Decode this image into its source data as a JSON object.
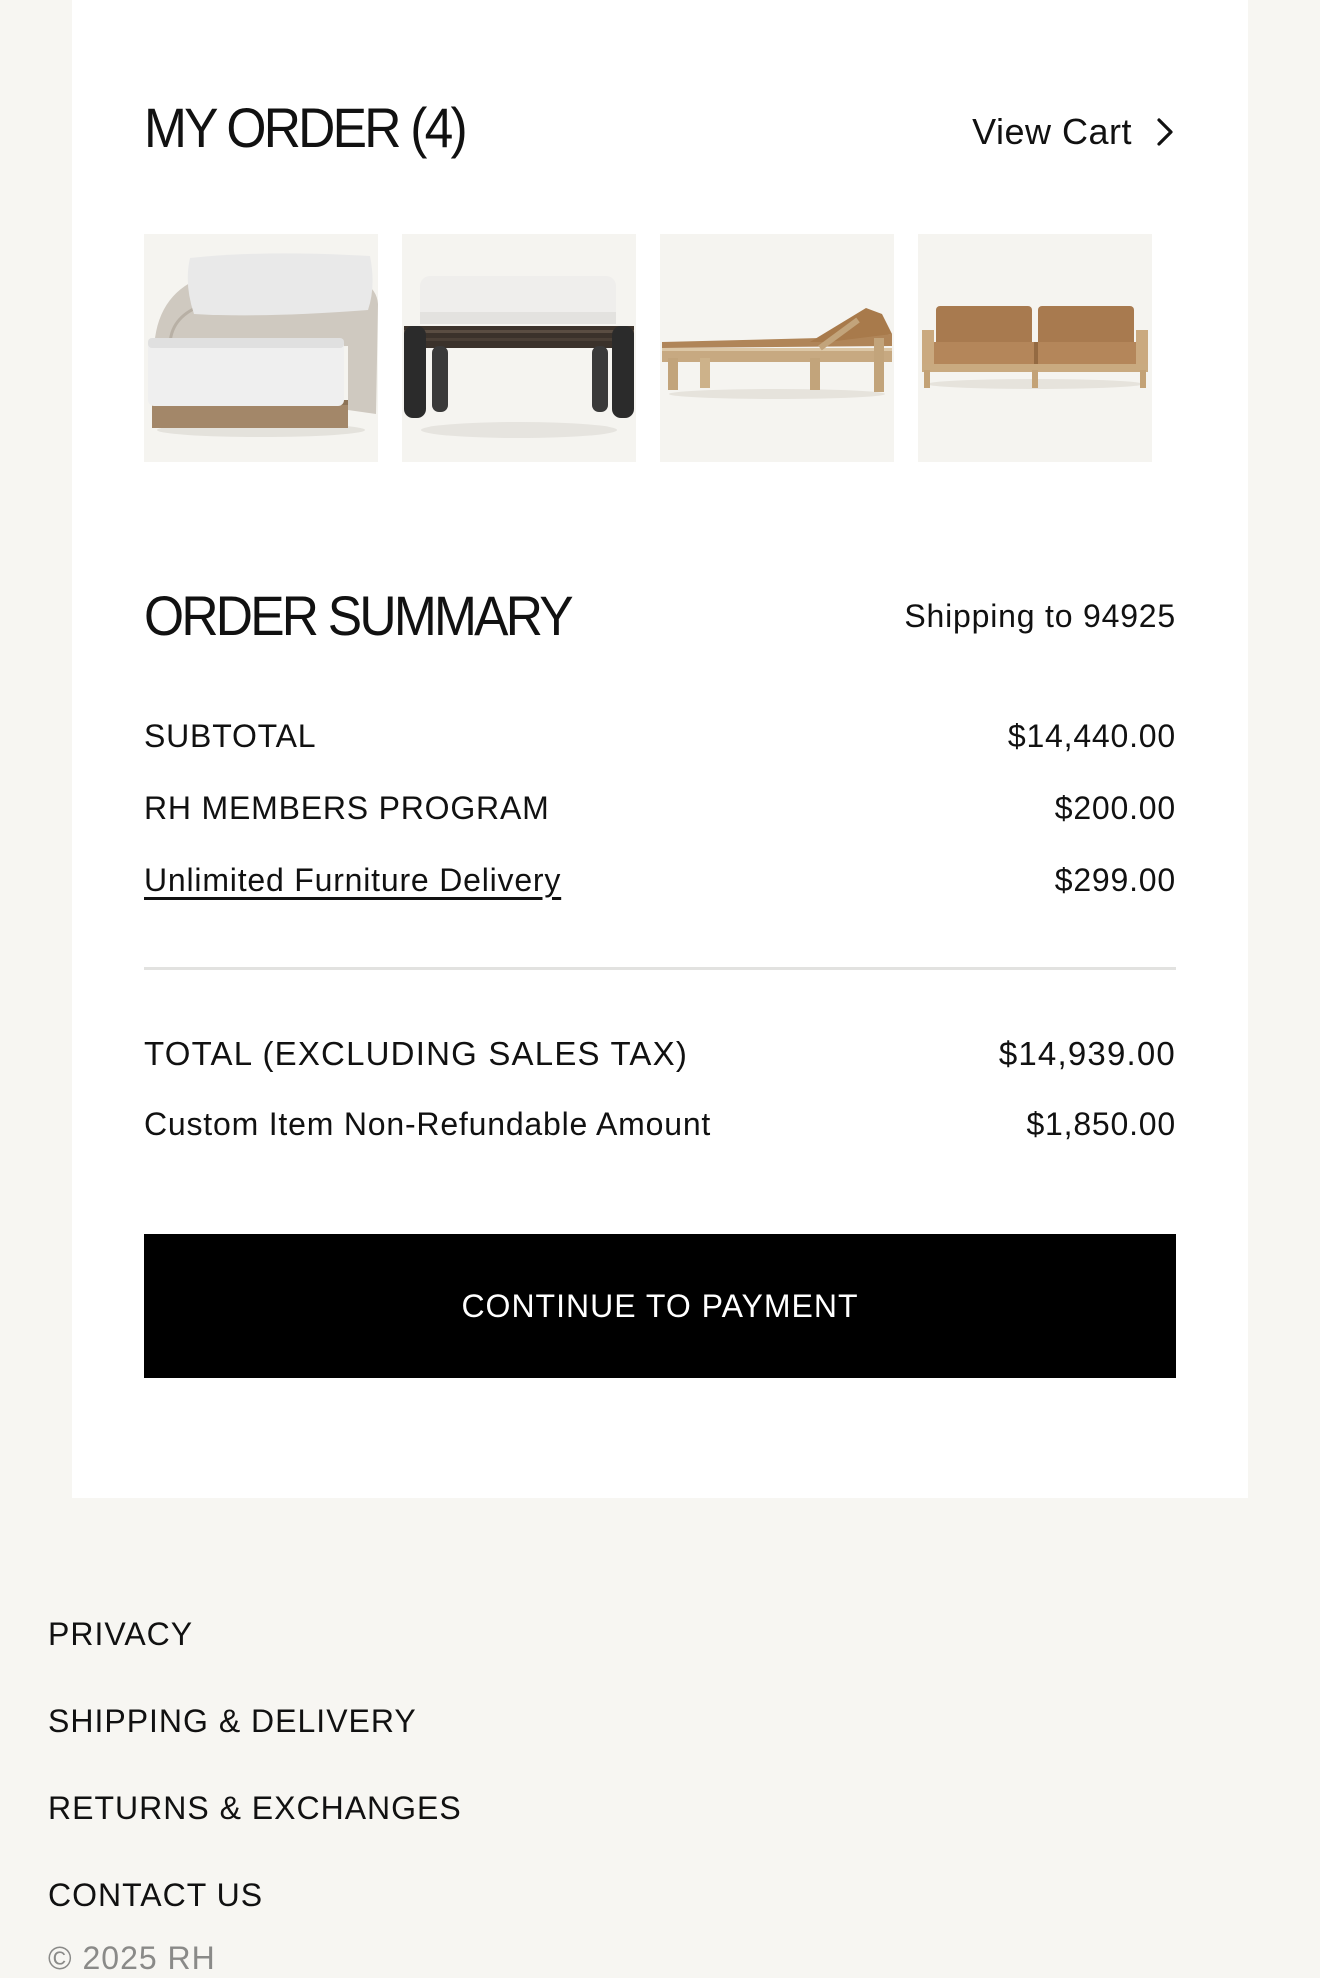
{
  "my_order": {
    "title": "MY ORDER (4)",
    "view_cart_label": "View Cart",
    "chevron_icon": "chevron-right-icon",
    "items": [
      {
        "product": "lounge-chair-icon"
      },
      {
        "product": "ottoman-icon"
      },
      {
        "product": "chaise-lounge-icon"
      },
      {
        "product": "sofa-icon"
      }
    ]
  },
  "order_summary": {
    "title": "ORDER SUMMARY",
    "shipping_to": "Shipping to 94925",
    "lines": [
      {
        "label": "SUBTOTAL",
        "value": "$14,440.00"
      },
      {
        "label": "RH MEMBERS PROGRAM",
        "value": "$200.00"
      },
      {
        "label": "Unlimited Furniture Delivery",
        "value": "$299.00"
      }
    ],
    "total": {
      "label": "TOTAL (EXCLUDING SALES TAX)",
      "value": "$14,939.00"
    },
    "custom_item": {
      "label": "Custom Item Non-Refundable Amount",
      "value": "$1,850.00"
    },
    "cta_label": "CONTINUE TO PAYMENT"
  },
  "footer": {
    "links": [
      "PRIVACY",
      "SHIPPING & DELIVERY",
      "RETURNS & EXCHANGES",
      "CONTACT US"
    ],
    "copyright": "© 2025 RH"
  },
  "colors": {
    "page_background": "#f7f6f2",
    "card_background": "#ffffff",
    "cta_background": "#000000",
    "cta_text": "#ffffff",
    "copyright_text": "#8a8a88"
  }
}
